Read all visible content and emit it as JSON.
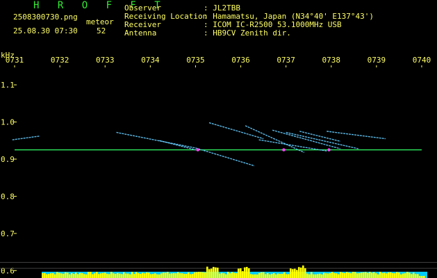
{
  "app_title": "H R O F F T",
  "file_name": "2508300730.png",
  "datetime": "25.08.30 07:30",
  "meteor_label": "meteor",
  "meteor_count": "52",
  "info": {
    "observer_key": "Observer",
    "observer_val": ": JL2TBB",
    "location_key": "Receiving Location",
    "location_val": ": Hamamatsu, Japan (N34°40' E137°43')",
    "receiver_key": "Receiver",
    "receiver_val": ": ICOM IC-R2500 53.1000MHz USB",
    "antenna_key": "Antenna",
    "antenna_val": ": HB9CV Zenith dir."
  },
  "colors": {
    "header_text": "#ffff66",
    "title": "#33ee33",
    "axis": "#ffff66",
    "carrier": "#33ff66",
    "trail": "#66ccff",
    "trail_hot": "#ff44ff",
    "bar_yellow": "#ffff00",
    "bar_cyan": "#00ccff"
  },
  "chart_data": {
    "type": "spectrogram",
    "ylabel": "kHz",
    "x_ticks": [
      "0731",
      "0732",
      "0733",
      "0734",
      "0735",
      "0736",
      "0737",
      "0738",
      "0739",
      "0740"
    ],
    "xlim": [
      730.8,
      740.2
    ],
    "y_ticks": [
      "1.1",
      "1.0",
      "0.9",
      "0.8",
      "0.7",
      "0.6"
    ],
    "y_tick_values": [
      1.1,
      1.0,
      0.9,
      0.8,
      0.7,
      0.6
    ],
    "ylim": [
      0.58,
      1.16
    ],
    "carrier_khz": 0.925,
    "trails": [
      {
        "x": [
          730.95,
          731.55
        ],
        "y": [
          0.952,
          0.962
        ]
      },
      {
        "x": [
          733.25,
          735.0
        ],
        "y": [
          0.972,
          0.93
        ]
      },
      {
        "x": [
          734.2,
          735.0
        ],
        "y": [
          0.95,
          0.925
        ]
      },
      {
        "x": [
          735.0,
          736.3
        ],
        "y": [
          0.93,
          0.882
        ]
      },
      {
        "x": [
          735.3,
          736.5
        ],
        "y": [
          0.998,
          0.955
        ]
      },
      {
        "x": [
          736.1,
          737.4
        ],
        "y": [
          0.99,
          0.918
        ]
      },
      {
        "x": [
          736.7,
          738.2
        ],
        "y": [
          0.978,
          0.928
        ]
      },
      {
        "x": [
          737.0,
          738.6
        ],
        "y": [
          0.972,
          0.928
        ]
      },
      {
        "x": [
          737.3,
          738.2
        ],
        "y": [
          0.975,
          0.948
        ]
      },
      {
        "x": [
          737.9,
          739.2
        ],
        "y": [
          0.975,
          0.955
        ]
      },
      {
        "x": [
          736.4,
          737.9
        ],
        "y": [
          0.952,
          0.922
        ]
      }
    ]
  }
}
